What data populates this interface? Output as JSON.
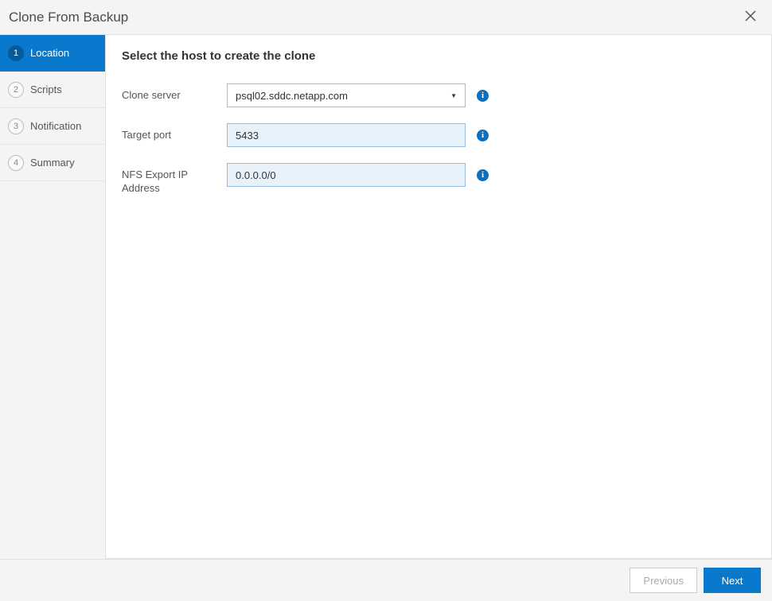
{
  "header": {
    "title": "Clone From Backup"
  },
  "sidebar": {
    "steps": [
      {
        "num": "1",
        "label": "Location"
      },
      {
        "num": "2",
        "label": "Scripts"
      },
      {
        "num": "3",
        "label": "Notification"
      },
      {
        "num": "4",
        "label": "Summary"
      }
    ]
  },
  "main": {
    "heading": "Select the host to create the clone",
    "form": {
      "clone_server_label": "Clone server",
      "clone_server_value": "psql02.sddc.netapp.com",
      "target_port_label": "Target port",
      "target_port_value": "5433",
      "nfs_label": "NFS Export IP Address",
      "nfs_value": "0.0.0.0/0"
    }
  },
  "footer": {
    "previous": "Previous",
    "next": "Next"
  }
}
